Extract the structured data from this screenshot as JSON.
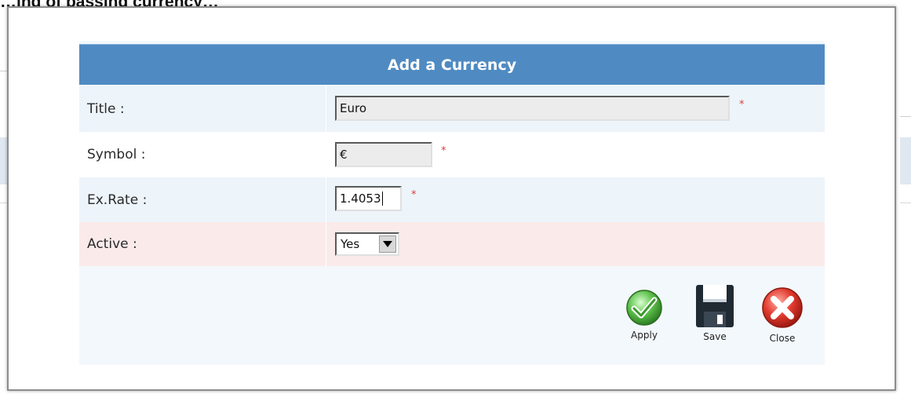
{
  "background": {
    "page_title": "…ing of passing currency…"
  },
  "dialog": {
    "title": "Add a Currency",
    "fields": {
      "title": {
        "label": "Title :",
        "value": "Euro",
        "required": "*"
      },
      "symbol": {
        "label": "Symbol :",
        "value": "€",
        "required": "*"
      },
      "rate": {
        "label": "Ex.Rate :",
        "value": "1.4053",
        "required": "*"
      },
      "active": {
        "label": "Active :",
        "value": "Yes"
      }
    },
    "buttons": {
      "apply": "Apply",
      "save": "Save",
      "close": "Close"
    }
  },
  "colors": {
    "header": "#4f8bc2",
    "required": "#e23b3b",
    "active_row": "#fbeaea"
  }
}
